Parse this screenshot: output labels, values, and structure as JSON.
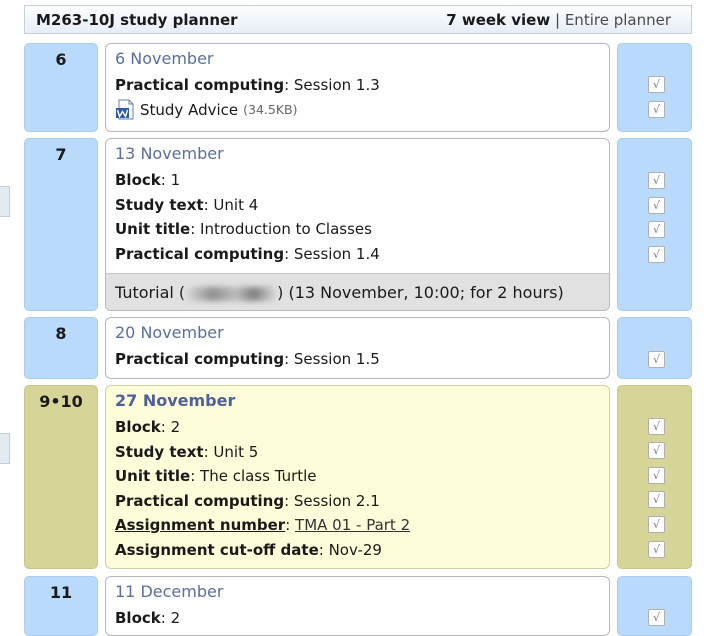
{
  "header": {
    "title": "M263-10J study planner",
    "current_view": "7 week view",
    "separator": "|",
    "other_view": "Entire planner"
  },
  "icons": {
    "doc": "word-document-icon",
    "check": "checkmark-icon"
  },
  "colors": {
    "week_bg": "#b9dafa",
    "current_week_bg": "#d6d597",
    "current_card_bg": "#fdfdd9",
    "date_text": "#5a6f9a"
  },
  "weeks": [
    {
      "week": "6",
      "date": "6 November",
      "rows": [
        {
          "k": "Practical computing",
          "v": "Session 1.3"
        }
      ],
      "doc": {
        "name": "Study Advice",
        "size": "(34.5KB)"
      }
    },
    {
      "week": "7",
      "date": "13 November",
      "rows": [
        {
          "k": "Block",
          "v": "1"
        },
        {
          "k": "Study text",
          "v": "Unit 4"
        },
        {
          "k": "Unit title",
          "v": "Introduction to Classes"
        },
        {
          "k": "Practical computing",
          "v": "Session 1.4"
        }
      ],
      "tutorial": {
        "prefix": "Tutorial (",
        "suffix": ") (13 November, 10:00; for 2 hours)"
      }
    },
    {
      "week": "8",
      "date": "20 November",
      "rows": [
        {
          "k": "Practical computing",
          "v": "Session 1.5"
        }
      ]
    },
    {
      "week": "9•10",
      "date": "27 November",
      "rows": [
        {
          "k": "Block",
          "v": "2"
        },
        {
          "k": "Study text",
          "v": "Unit 5"
        },
        {
          "k": "Unit title",
          "v": "The class Turtle"
        },
        {
          "k": "Practical computing",
          "v": "Session 2.1"
        },
        {
          "k": "Assignment number",
          "v": "TMA 01 - Part 2"
        },
        {
          "k": "Assignment cut-off date",
          "v": "Nov-29"
        }
      ]
    },
    {
      "week": "11",
      "date": "11 December",
      "rows": [
        {
          "k": "Block",
          "v": "2"
        }
      ]
    }
  ],
  "checkmark": "√"
}
